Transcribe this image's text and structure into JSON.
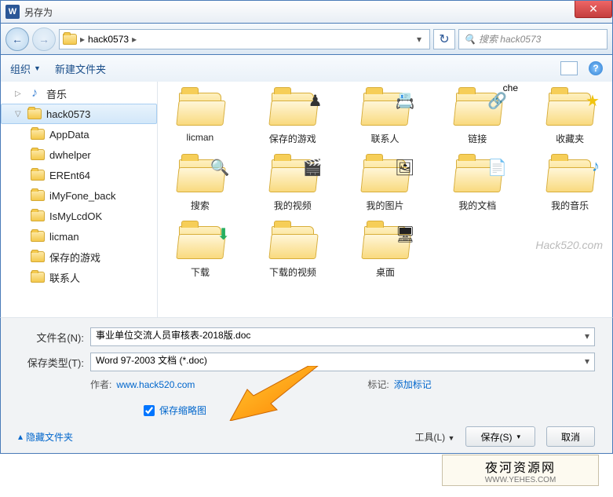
{
  "window": {
    "title": "另存为"
  },
  "nav": {
    "path": [
      "hack0573"
    ],
    "search_placeholder": "搜索 hack0573"
  },
  "toolbar": {
    "organize": "组织",
    "new_folder": "新建文件夹"
  },
  "tree": [
    {
      "label": "音乐",
      "icon": "music",
      "indent": 0
    },
    {
      "label": "hack0573",
      "icon": "folder",
      "indent": 0,
      "selected": true,
      "expanded": true
    },
    {
      "label": "AppData",
      "icon": "folder",
      "indent": 1
    },
    {
      "label": "dwhelper",
      "icon": "folder",
      "indent": 1
    },
    {
      "label": "EREnt64",
      "icon": "folder",
      "indent": 1
    },
    {
      "label": "iMyFone_back",
      "icon": "folder",
      "indent": 1
    },
    {
      "label": "IsMyLcdOK",
      "icon": "folder",
      "indent": 1
    },
    {
      "label": "licman",
      "icon": "folder",
      "indent": 1
    },
    {
      "label": "保存的游戏",
      "icon": "folder",
      "indent": 1
    },
    {
      "label": "联系人",
      "icon": "folder",
      "indent": 1
    }
  ],
  "top_fragment": "che",
  "folders": [
    {
      "label": "licman",
      "badge": ""
    },
    {
      "label": "保存的游戏",
      "badge": "♠"
    },
    {
      "label": "联系人",
      "badge": "👤"
    },
    {
      "label": "链接",
      "badge": "↯"
    },
    {
      "label": "收藏夹",
      "badge": "★"
    },
    {
      "label": "搜索",
      "badge": "🔍"
    },
    {
      "label": "我的视频",
      "badge": "🎬"
    },
    {
      "label": "我的图片",
      "badge": "🖼"
    },
    {
      "label": "我的文档",
      "badge": "📄"
    },
    {
      "label": "我的音乐",
      "badge": "♪"
    },
    {
      "label": "下载",
      "badge": "⬇"
    },
    {
      "label": "下载的视频",
      "badge": ""
    },
    {
      "label": "桌面",
      "badge": "🖥"
    }
  ],
  "watermark": "Hack520.com",
  "form": {
    "filename_label": "文件名(N):",
    "filename_value": "事业单位交流人员审核表-2018版.doc",
    "filetype_label": "保存类型(T):",
    "filetype_value": "Word 97-2003 文档 (*.doc)",
    "author_label": "作者:",
    "author_value": "www.hack520.com",
    "tag_label": "标记:",
    "tag_value": "添加标记",
    "thumbnail_label": "保存缩略图",
    "hide_folders": "隐藏文件夹",
    "tools_label": "工具(L)",
    "save_button": "保存(S)",
    "cancel_button": "取消"
  },
  "stamp": {
    "name": "夜河资源网",
    "url": "WWW.YEHES.COM"
  }
}
